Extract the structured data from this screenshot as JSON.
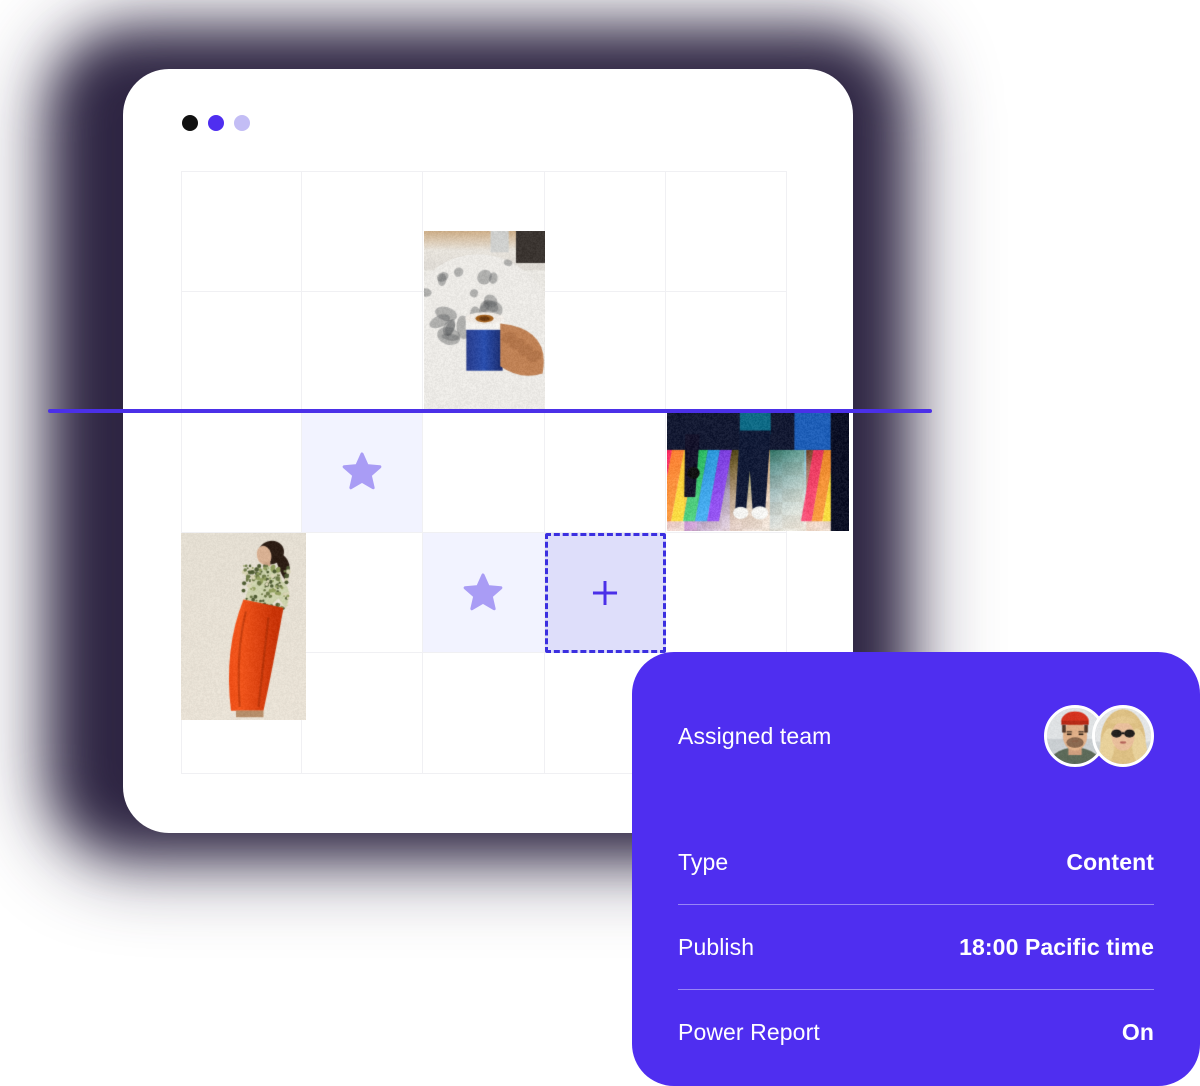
{
  "window": {
    "dots": [
      {
        "name": "dot-black",
        "color": "#111111"
      },
      {
        "name": "dot-purple",
        "color": "#4f2ef0"
      },
      {
        "name": "dot-lavender",
        "color": "#c3bdf5"
      }
    ]
  },
  "calendar": {
    "columns": 5,
    "rows": 5,
    "grid_line_color": "#f0f0f3",
    "highlight_color": "#f2f3ff",
    "dropzone_fill": "#dedefa",
    "dropzone_border": "#3b2fe0",
    "star_color": "#a99cf5",
    "cells": [
      {
        "row": 1,
        "col": 1,
        "state": "empty"
      },
      {
        "row": 1,
        "col": 2,
        "state": "empty"
      },
      {
        "row": 1,
        "col": 3,
        "state": "empty"
      },
      {
        "row": 1,
        "col": 4,
        "state": "empty"
      },
      {
        "row": 1,
        "col": 5,
        "state": "empty"
      },
      {
        "row": 2,
        "col": 1,
        "state": "empty"
      },
      {
        "row": 2,
        "col": 2,
        "state": "empty"
      },
      {
        "row": 2,
        "col": 3,
        "state": "media"
      },
      {
        "row": 2,
        "col": 4,
        "state": "empty"
      },
      {
        "row": 2,
        "col": 5,
        "state": "empty"
      },
      {
        "row": 3,
        "col": 1,
        "state": "empty"
      },
      {
        "row": 3,
        "col": 2,
        "state": "starred"
      },
      {
        "row": 3,
        "col": 3,
        "state": "empty"
      },
      {
        "row": 3,
        "col": 4,
        "state": "empty"
      },
      {
        "row": 3,
        "col": 5,
        "state": "media"
      },
      {
        "row": 4,
        "col": 1,
        "state": "media"
      },
      {
        "row": 4,
        "col": 2,
        "state": "empty"
      },
      {
        "row": 4,
        "col": 3,
        "state": "starred"
      },
      {
        "row": 4,
        "col": 4,
        "state": "dropzone"
      },
      {
        "row": 4,
        "col": 5,
        "state": "empty"
      },
      {
        "row": 5,
        "col": 1,
        "state": "empty"
      },
      {
        "row": 5,
        "col": 2,
        "state": "empty"
      },
      {
        "row": 5,
        "col": 3,
        "state": "empty"
      },
      {
        "row": 5,
        "col": 4,
        "state": "empty"
      },
      {
        "row": 5,
        "col": 5,
        "state": "empty"
      }
    ],
    "media_tiles": [
      {
        "id": "coffee",
        "description": "hand holding blue iced coffee cup on marble table"
      },
      {
        "id": "model",
        "description": "fashion model in orange trousers and floral top"
      },
      {
        "id": "dance",
        "description": "legs on colorful lit disco dance floor"
      }
    ]
  },
  "timeline": {
    "marker_color": "#4b30e8"
  },
  "detail_card": {
    "background": "#4f2ef0",
    "assigned_team_label": "Assigned team",
    "avatars": [
      {
        "name": "avatar-man-red-beanie",
        "alt": "Man wearing red beanie"
      },
      {
        "name": "avatar-woman-sunglasses",
        "alt": "Woman with blonde hair and sunglasses"
      }
    ],
    "rows": [
      {
        "label": "Type",
        "value": "Content"
      },
      {
        "label": "Publish",
        "value": "18:00 Pacific time"
      },
      {
        "label": "Power Report",
        "value": "On"
      }
    ]
  }
}
